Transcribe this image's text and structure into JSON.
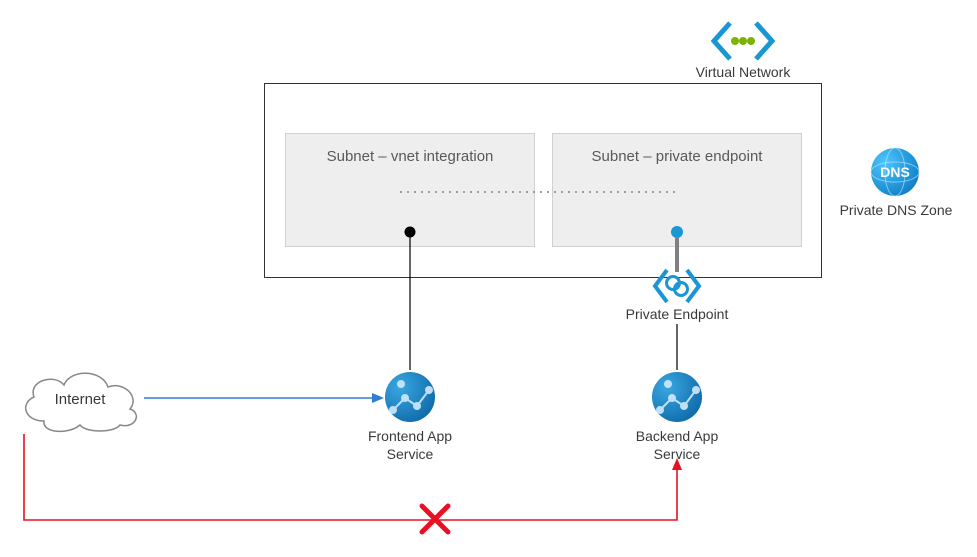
{
  "vnet": {
    "label": "Virtual Network"
  },
  "subnet1": {
    "label": "Subnet – vnet integration"
  },
  "subnet2": {
    "label": "Subnet – private endpoint"
  },
  "privateEndpoint": {
    "label": "Private Endpoint"
  },
  "privateDns": {
    "label": "Private DNS Zone",
    "badge": "DNS"
  },
  "frontend": {
    "label": "Frontend App\nService"
  },
  "backend": {
    "label": "Backend App\nService"
  },
  "internet": {
    "label": "Internet"
  }
}
